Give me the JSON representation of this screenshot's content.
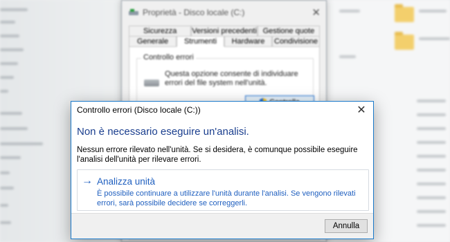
{
  "properties_window": {
    "title": "Proprietà - Disco locale (C:)",
    "tabs_row1": [
      "Sicurezza",
      "Versioni precedenti",
      "Gestione quote"
    ],
    "tabs_row2": [
      "Generale",
      "Strumenti",
      "Hardware",
      "Condivisione"
    ],
    "active_tab": "Strumenti",
    "group_title": "Controllo errori",
    "group_description": "Questa opzione consente di individuare errori del file system nell'unità.",
    "check_button": "Controlla"
  },
  "dialog": {
    "title": "Controllo errori (Disco locale (C:))",
    "heading": "Non è necessario eseguire un'analisi.",
    "message": "Nessun errore rilevato nell'unità. Se si desidera, è comunque possibile eseguire l'analisi dell'unità per rilevare errori.",
    "command_link": {
      "title": "Analizza unità",
      "description": "È possibile continuare a utilizzare l'unità durante l'analisi. Se vengono rilevati errori, sarà possibile decidere se correggerli."
    },
    "cancel_button": "Annulla"
  }
}
